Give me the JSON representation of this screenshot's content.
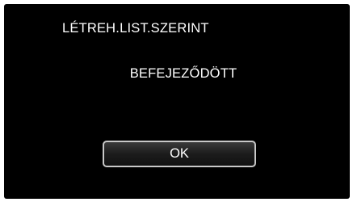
{
  "screen": {
    "title": "LÉTREH.LIST.SZERINT",
    "message": "BEFEJEZŐDÖTT",
    "ok_label": "OK"
  },
  "colors": {
    "background": "#000000",
    "text": "#ffffff",
    "button_border": "#c8c8c8"
  }
}
